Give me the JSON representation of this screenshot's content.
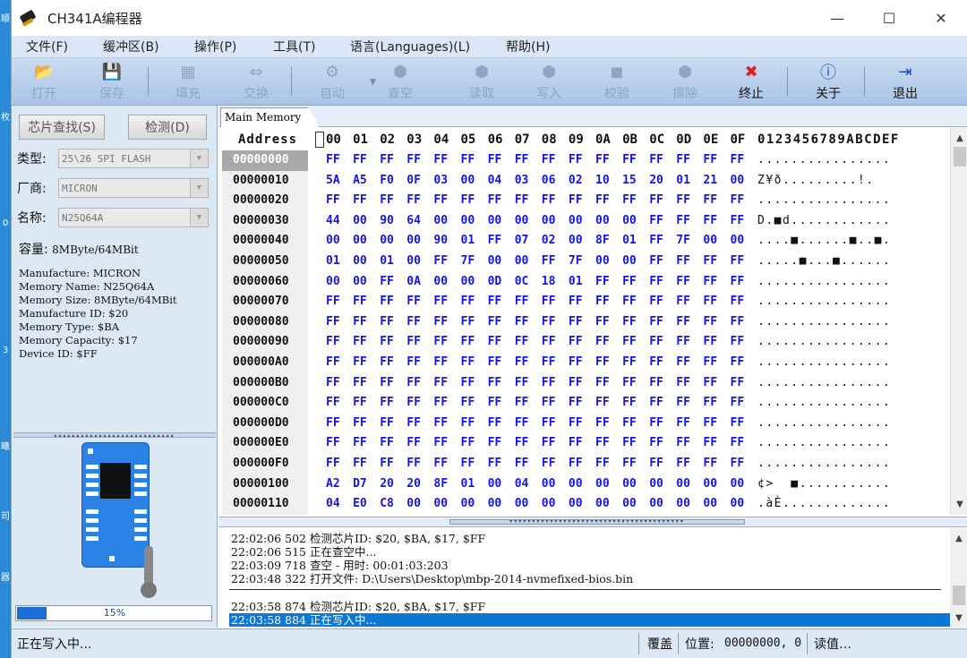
{
  "window": {
    "title": "CH341A编程器",
    "minimize": "—",
    "maximize": "☐",
    "close": "✕"
  },
  "menu": [
    "文件(F)",
    "缓冲区(B)",
    "操作(P)",
    "工具(T)",
    "语言(Languages)(L)",
    "帮助(H)"
  ],
  "toolbar": [
    {
      "label": "打开",
      "icon": "folder-icon",
      "glyph": "📂",
      "enabled": false
    },
    {
      "label": "保存",
      "icon": "save-icon",
      "glyph": "💾",
      "enabled": false
    },
    {
      "label": "填充",
      "icon": "fill-icon",
      "glyph": "▦",
      "enabled": false
    },
    {
      "label": "交换",
      "icon": "swap-icon",
      "glyph": "⇔",
      "enabled": false
    },
    {
      "label": "自动",
      "icon": "auto-icon",
      "glyph": "⚙",
      "enabled": false
    },
    {
      "label": "查空",
      "icon": "blank-check-icon",
      "glyph": "⬢",
      "enabled": false
    },
    {
      "label": "读取",
      "icon": "read-icon",
      "glyph": "⬢",
      "enabled": false
    },
    {
      "label": "写入",
      "icon": "write-icon",
      "glyph": "⬢",
      "enabled": false
    },
    {
      "label": "校验",
      "icon": "verify-icon",
      "glyph": "◼",
      "enabled": false
    },
    {
      "label": "擦除",
      "icon": "erase-icon",
      "glyph": "⬢",
      "enabled": false
    },
    {
      "label": "终止",
      "icon": "stop-icon",
      "glyph": "✖",
      "enabled": true,
      "color": "#e02020"
    },
    {
      "label": "关于",
      "icon": "info-icon",
      "glyph": "ⓘ",
      "enabled": true,
      "color": "#1a4fc0"
    },
    {
      "label": "退出",
      "icon": "exit-icon",
      "glyph": "⇥",
      "enabled": true,
      "color": "#1a4fc0"
    }
  ],
  "left": {
    "find_chip": "芯片查找(S)",
    "detect": "检测(D)",
    "type_label": "类型:",
    "type_value": "25\\26 SPI FLASH",
    "vendor_label": "厂商:",
    "vendor_value": "MICRON",
    "name_label": "名称:",
    "name_value": "N25Q64A",
    "capacity_label": "容量:",
    "capacity_value": "8MByte/64MBit",
    "info": [
      "Manufacture: MICRON",
      "Memory Name: N25Q64A",
      "Memory Size: 8MByte/64MBit",
      "Manufacture ID: $20",
      "Memory Type: $BA",
      "Memory Capacity: $17",
      "Device ID: $FF"
    ],
    "progress_value": 0.15,
    "progress_text": "15%"
  },
  "tab": "Main Memory",
  "hex": {
    "address_header": "Address",
    "columns": [
      "00",
      "01",
      "02",
      "03",
      "04",
      "05",
      "06",
      "07",
      "08",
      "09",
      "0A",
      "0B",
      "0C",
      "0D",
      "0E",
      "0F"
    ],
    "ascii_header": "0123456789ABCDEF",
    "rows": [
      {
        "addr": "00000000",
        "bytes": "FF FF FF FF FF FF FF FF FF FF FF FF FF FF FF FF",
        "ascii": "................",
        "selected": true
      },
      {
        "addr": "00000010",
        "bytes": "5A A5 F0 0F 03 00 04 03 06 02 10 15 20 01 21 00",
        "ascii": "Z¥ð.........!."
      },
      {
        "addr": "00000020",
        "bytes": "FF FF FF FF FF FF FF FF FF FF FF FF FF FF FF FF",
        "ascii": "................"
      },
      {
        "addr": "00000030",
        "bytes": "44 00 90 64 00 00 00 00 00 00 00 00 FF FF FF FF",
        "ascii": "D.■d............"
      },
      {
        "addr": "00000040",
        "bytes": "00 00 00 00 90 01 FF 07 02 00 8F 01 FF 7F 00 00",
        "ascii": "....■......■..■."
      },
      {
        "addr": "00000050",
        "bytes": "01 00 01 00 FF 7F 00 00 FF 7F 00 00 FF FF FF FF",
        "ascii": ".....■...■......"
      },
      {
        "addr": "00000060",
        "bytes": "00 00 FF 0A 00 00 0D 0C 18 01 FF FF FF FF FF FF",
        "ascii": "................"
      },
      {
        "addr": "00000070",
        "bytes": "FF FF FF FF FF FF FF FF FF FF FF FF FF FF FF FF",
        "ascii": "................"
      },
      {
        "addr": "00000080",
        "bytes": "FF FF FF FF FF FF FF FF FF FF FF FF FF FF FF FF",
        "ascii": "................"
      },
      {
        "addr": "00000090",
        "bytes": "FF FF FF FF FF FF FF FF FF FF FF FF FF FF FF FF",
        "ascii": "................"
      },
      {
        "addr": "000000A0",
        "bytes": "FF FF FF FF FF FF FF FF FF FF FF FF FF FF FF FF",
        "ascii": "................"
      },
      {
        "addr": "000000B0",
        "bytes": "FF FF FF FF FF FF FF FF FF FF FF FF FF FF FF FF",
        "ascii": "................"
      },
      {
        "addr": "000000C0",
        "bytes": "FF FF FF FF FF FF FF FF FF FF FF FF FF FF FF FF",
        "ascii": "................"
      },
      {
        "addr": "000000D0",
        "bytes": "FF FF FF FF FF FF FF FF FF FF FF FF FF FF FF FF",
        "ascii": "................"
      },
      {
        "addr": "000000E0",
        "bytes": "FF FF FF FF FF FF FF FF FF FF FF FF FF FF FF FF",
        "ascii": "................"
      },
      {
        "addr": "000000F0",
        "bytes": "FF FF FF FF FF FF FF FF FF FF FF FF FF FF FF FF",
        "ascii": "................"
      },
      {
        "addr": "00000100",
        "bytes": "A2 D7 20 20 8F 01 00 04 00 00 00 00 00 00 00 00",
        "ascii": "¢>  ■..........."
      },
      {
        "addr": "00000110",
        "bytes": "04 E0 C8 00 00 00 00 00 00 00 00 00 00 00 00 00",
        "ascii": ".àÈ............."
      }
    ]
  },
  "log": [
    {
      "time": "22:02:06 502",
      "msg": "检测芯片ID: $20, $BA, $17, $FF"
    },
    {
      "time": "22:02:06 515",
      "msg": "正在查空中..."
    },
    {
      "time": "22:03:09 718",
      "msg": "查空 - 用时: 00:01:03:203"
    },
    {
      "time": "22:03:48 322",
      "msg": "打开文件: D:\\Users\\Desktop\\mbp-2014-nvmefixed-bios.bin"
    },
    {
      "time": "22:03:58 874",
      "msg": "检测芯片ID: $20, $BA, $17, $FF"
    },
    {
      "time": "22:03:58 884",
      "msg": "正在写入中..."
    }
  ],
  "status": {
    "left": "正在写入中...",
    "mode": "覆盖",
    "position_label": "位置:",
    "position_value": "00000000, 0",
    "tail": "读值…"
  },
  "desktop_strip": [
    "顺",
    "枚",
    "0",
    "3",
    "曦",
    "司",
    "器"
  ],
  "colors": {
    "hex_bytes": "#1515e0",
    "selection": "#0a78d7",
    "toolbar_bg": "#b9cfec",
    "progress": "#1c6ed6"
  }
}
